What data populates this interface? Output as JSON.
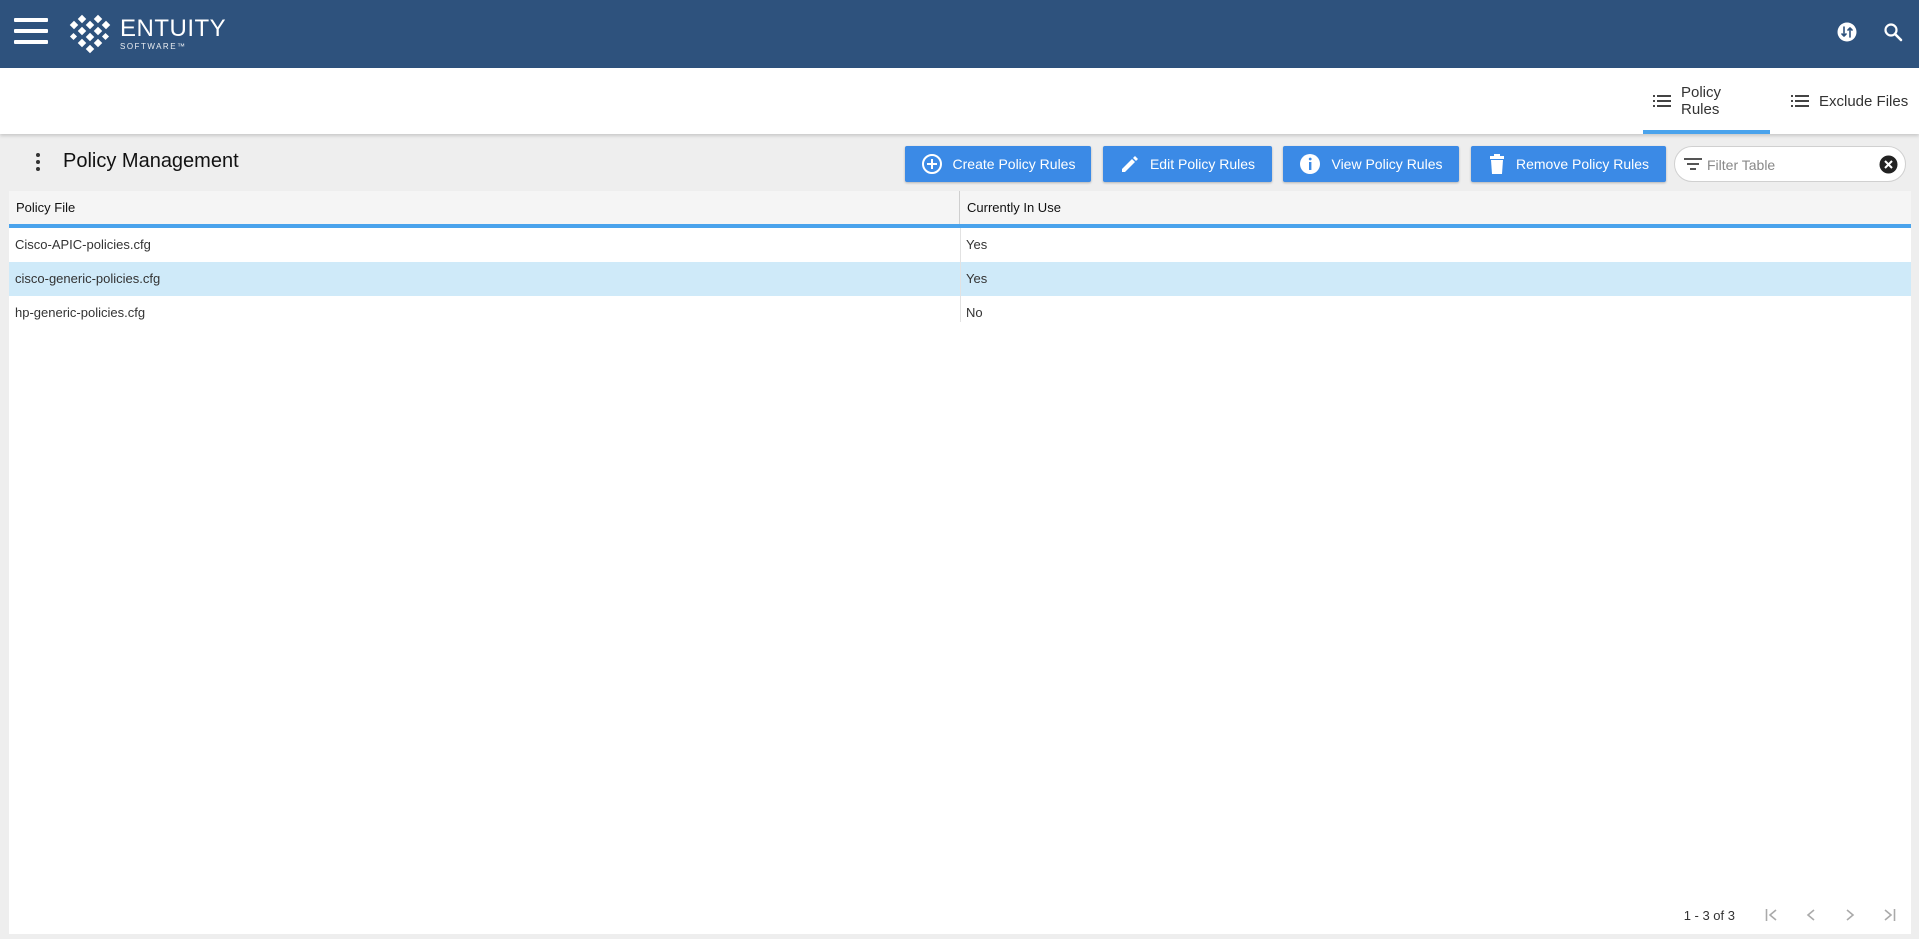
{
  "app": {
    "logo_text": "ENTUITY",
    "logo_subtext": "SOFTWARE™",
    "colors": {
      "header": "#2e527d",
      "accent": "#3b8ae6",
      "tab_underline": "#4aa3ec",
      "selected_row": "#cfeaf9"
    },
    "icons": [
      "menu-icon",
      "entuity-logo",
      "sync-icon",
      "search-icon"
    ]
  },
  "tabs": [
    {
      "label": "Policy Rules",
      "icon": "list-icon",
      "active": true
    },
    {
      "label": "Exclude Files",
      "icon": "list-icon",
      "active": false
    }
  ],
  "panel": {
    "title": "Policy Management",
    "buttons": {
      "create": "Create Policy Rules",
      "edit": "Edit Policy Rules",
      "view": "View Policy Rules",
      "remove": "Remove Policy Rules"
    },
    "filter": {
      "placeholder": "Filter Table",
      "value": ""
    }
  },
  "table": {
    "columns": [
      "Policy File",
      "Currently In Use"
    ],
    "rows": [
      {
        "file": "Cisco-APIC-policies.cfg",
        "in_use": "Yes",
        "selected": false
      },
      {
        "file": "cisco-generic-policies.cfg",
        "in_use": "Yes",
        "selected": true
      },
      {
        "file": "hp-generic-policies.cfg",
        "in_use": "No",
        "selected": false
      }
    ]
  },
  "pagination": {
    "range_text": "1 - 3 of 3"
  }
}
